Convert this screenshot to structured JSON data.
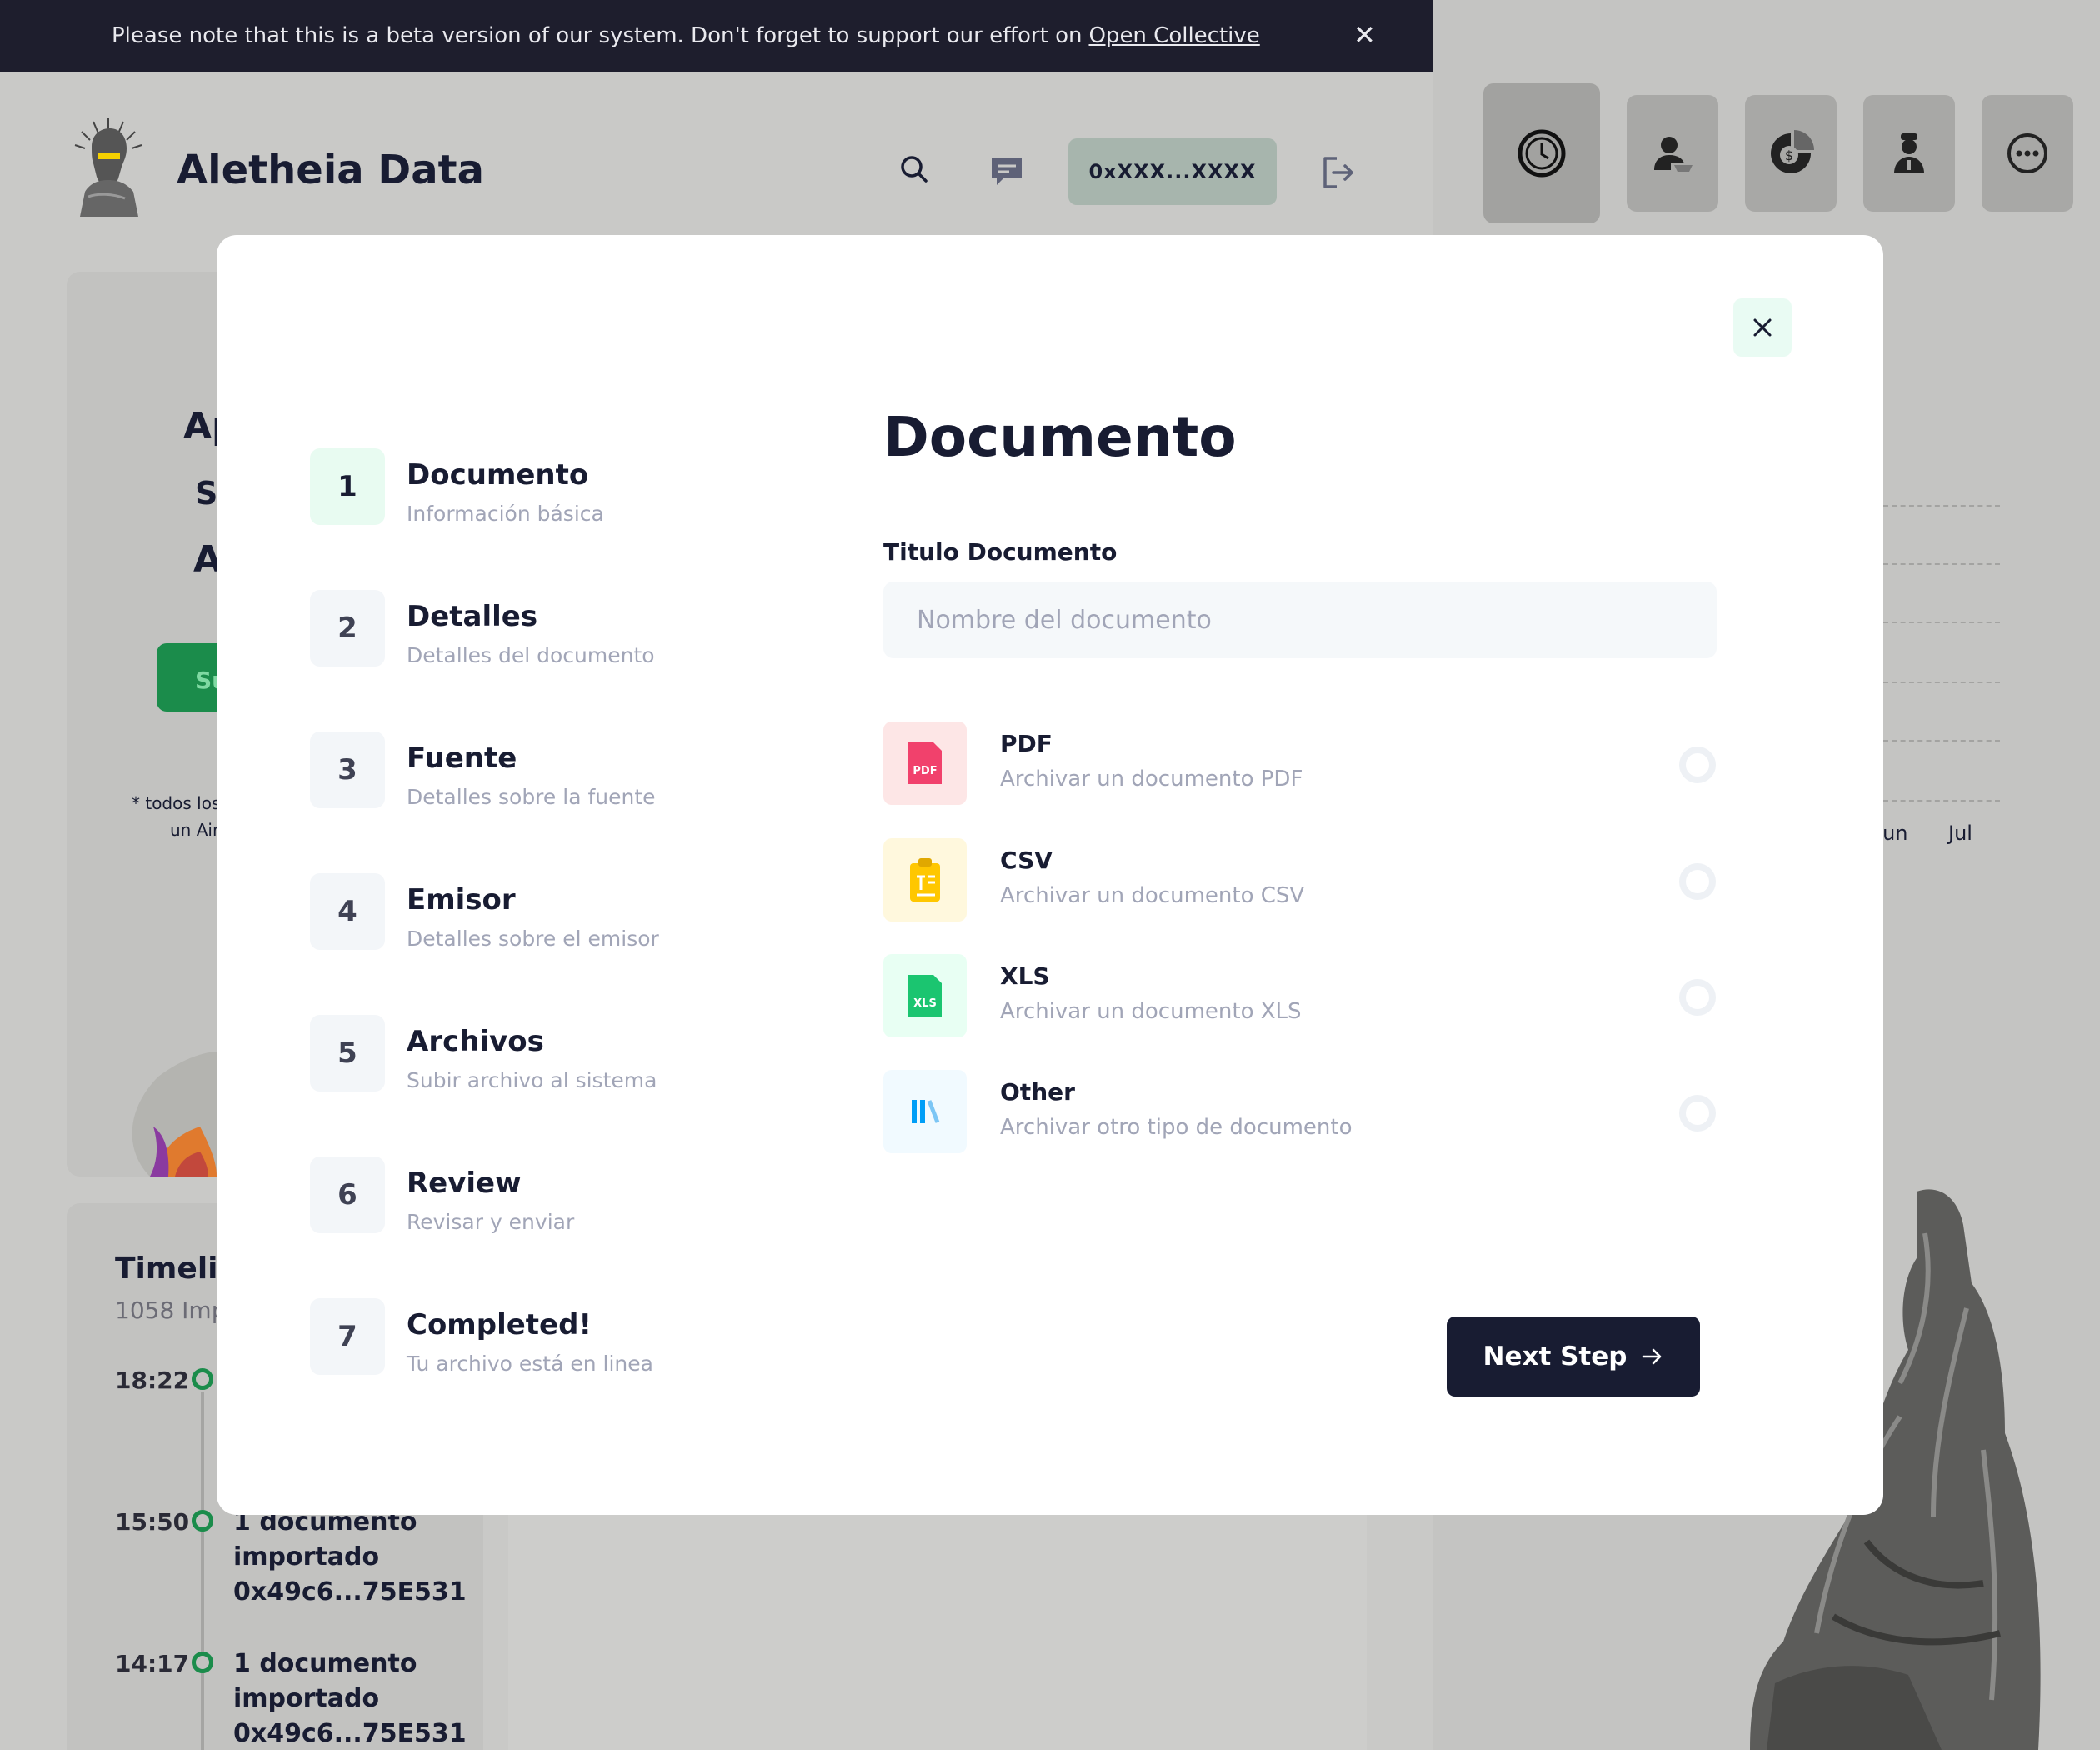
{
  "banner": {
    "message": "Please note that this is a beta version of our system. Don't forget to support our effort on",
    "link": "Open Collective",
    "close": "✕"
  },
  "header": {
    "app_title": "Aletheia Data",
    "wallet": "0xXXX...XXXX"
  },
  "toolbar": {
    "icons": [
      "clock-icon",
      "user-icon",
      "coin-chart-icon",
      "officer-icon",
      "more-icon"
    ]
  },
  "background": {
    "partial_lines": [
      "Ap",
      "S",
      "A"
    ],
    "green_button": "Su",
    "note_lines": [
      "* todos los",
      "un Air"
    ],
    "chart_months": [
      "Jun",
      "Jul"
    ],
    "timeline": {
      "title": "Timelin",
      "subtitle": "1058 Imp",
      "items": [
        {
          "time": "18:22",
          "text": ""
        },
        {
          "time": "15:50",
          "text": "1 documento importado 0x49c6...75E531"
        },
        {
          "time": "14:17",
          "text": "1 documento importado 0x49c6...75E531"
        }
      ]
    }
  },
  "modal": {
    "close": "✕",
    "steps": [
      {
        "number": "1",
        "label": "Documento",
        "desc": "Información básica"
      },
      {
        "number": "2",
        "label": "Detalles",
        "desc": "Detalles del documento"
      },
      {
        "number": "3",
        "label": "Fuente",
        "desc": "Detalles sobre la fuente"
      },
      {
        "number": "4",
        "label": "Emisor",
        "desc": "Detalles sobre el emisor"
      },
      {
        "number": "5",
        "label": "Archivos",
        "desc": "Subir archivo al sistema"
      },
      {
        "number": "6",
        "label": "Review",
        "desc": "Revisar y enviar"
      },
      {
        "number": "7",
        "label": "Completed!",
        "desc": "Tu archivo está en linea"
      }
    ],
    "heading": "Documento",
    "field_label": "Titulo Documento",
    "field_placeholder": "Nombre del documento",
    "field_value": "",
    "options": [
      {
        "name": "PDF",
        "desc": "Archivar un documento PDF",
        "icon": "pdf-icon",
        "badge": "PDF"
      },
      {
        "name": "CSV",
        "desc": "Archivar un documento CSV",
        "icon": "csv-icon",
        "badge": ""
      },
      {
        "name": "XLS",
        "desc": "Archivar un documento XLS",
        "icon": "xls-icon",
        "badge": "XLS"
      },
      {
        "name": "Other",
        "desc": "Archivar otro tipo de documento",
        "icon": "other-icon",
        "badge": ""
      }
    ],
    "next_button": "Next Step"
  },
  "colors": {
    "primary_dark": "#181c32",
    "success_green": "#1b8c4b",
    "pdf_bg": "#fde6e6",
    "pdf_red": "#f1416c",
    "csv_bg": "#fff8dd",
    "csv_yellow": "#ffc700",
    "xls_bg": "#e8fff3",
    "xls_green": "#1bc570",
    "other_bg": "#f1faff",
    "other_blue": "#009ef7"
  }
}
